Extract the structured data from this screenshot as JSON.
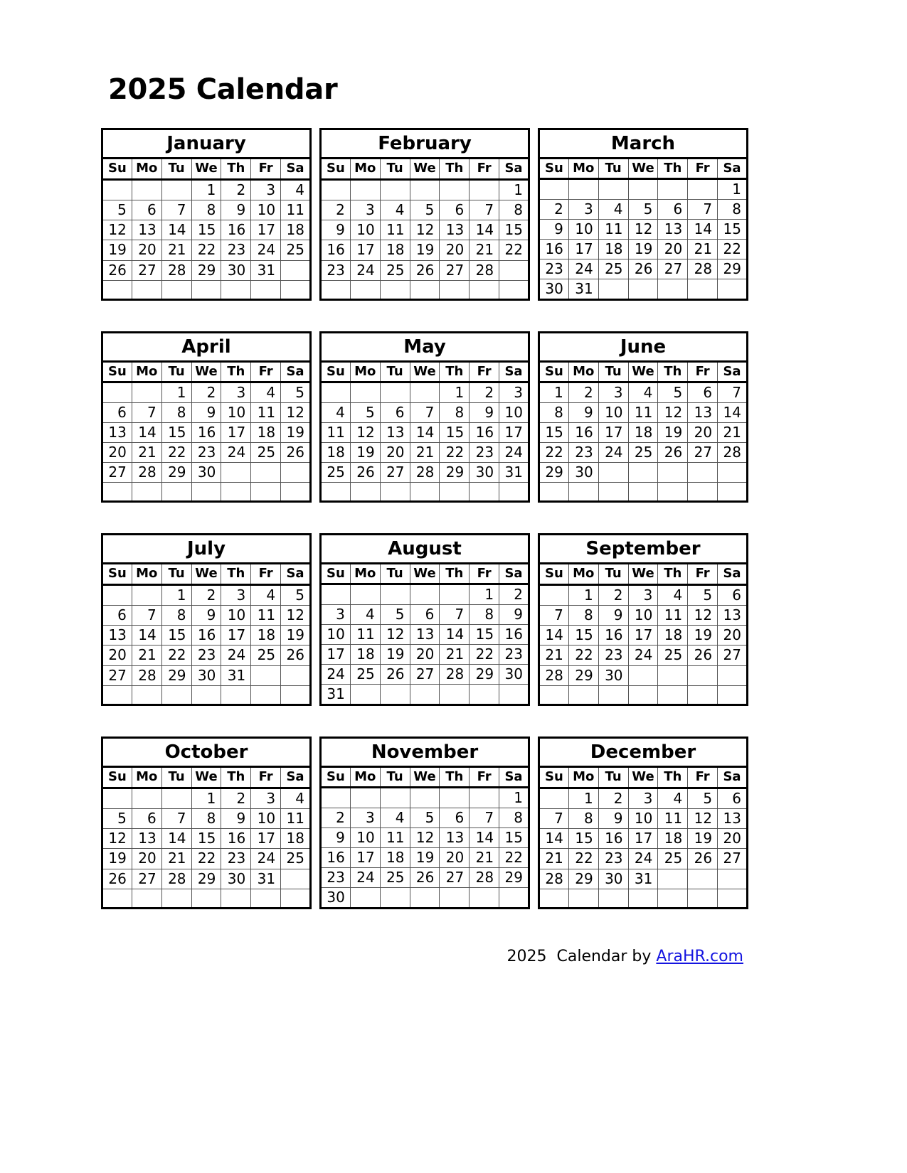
{
  "title": "2025 Calendar",
  "year": "2025",
  "weekday_headers": [
    "Su",
    "Mo",
    "Tu",
    "We",
    "Th",
    "Fr",
    "Sa"
  ],
  "footer": {
    "year": "2025",
    "text": "Calendar by",
    "link_label": "AraHR.com",
    "link_color": "#1414e0"
  },
  "colors": {
    "text": "#000000",
    "background": "#ffffff",
    "outer_border": "#000000",
    "cell_border": "#555555",
    "link": "#1414e0"
  },
  "quarters": [
    {
      "months": [
        {
          "name": "January",
          "weeks": [
            [
              "",
              "",
              "",
              "1",
              "2",
              "3",
              "4"
            ],
            [
              "5",
              "6",
              "7",
              "8",
              "9",
              "10",
              "11"
            ],
            [
              "12",
              "13",
              "14",
              "15",
              "16",
              "17",
              "18"
            ],
            [
              "19",
              "20",
              "21",
              "22",
              "23",
              "24",
              "25"
            ],
            [
              "26",
              "27",
              "28",
              "29",
              "30",
              "31",
              ""
            ],
            [
              "",
              "",
              "",
              "",
              "",
              "",
              ""
            ]
          ]
        },
        {
          "name": "February",
          "weeks": [
            [
              "",
              "",
              "",
              "",
              "",
              "",
              "1"
            ],
            [
              "2",
              "3",
              "4",
              "5",
              "6",
              "7",
              "8"
            ],
            [
              "9",
              "10",
              "11",
              "12",
              "13",
              "14",
              "15"
            ],
            [
              "16",
              "17",
              "18",
              "19",
              "20",
              "21",
              "22"
            ],
            [
              "23",
              "24",
              "25",
              "26",
              "27",
              "28",
              ""
            ],
            [
              "",
              "",
              "",
              "",
              "",
              "",
              ""
            ]
          ]
        },
        {
          "name": "March",
          "weeks": [
            [
              "",
              "",
              "",
              "",
              "",
              "",
              "1"
            ],
            [
              "2",
              "3",
              "4",
              "5",
              "6",
              "7",
              "8"
            ],
            [
              "9",
              "10",
              "11",
              "12",
              "13",
              "14",
              "15"
            ],
            [
              "16",
              "17",
              "18",
              "19",
              "20",
              "21",
              "22"
            ],
            [
              "23",
              "24",
              "25",
              "26",
              "27",
              "28",
              "29"
            ],
            [
              "30",
              "31",
              "",
              "",
              "",
              "",
              ""
            ]
          ]
        }
      ]
    },
    {
      "months": [
        {
          "name": "April",
          "weeks": [
            [
              "",
              "",
              "1",
              "2",
              "3",
              "4",
              "5"
            ],
            [
              "6",
              "7",
              "8",
              "9",
              "10",
              "11",
              "12"
            ],
            [
              "13",
              "14",
              "15",
              "16",
              "17",
              "18",
              "19"
            ],
            [
              "20",
              "21",
              "22",
              "23",
              "24",
              "25",
              "26"
            ],
            [
              "27",
              "28",
              "29",
              "30",
              "",
              "",
              ""
            ],
            [
              "",
              "",
              "",
              "",
              "",
              "",
              ""
            ]
          ]
        },
        {
          "name": "May",
          "weeks": [
            [
              "",
              "",
              "",
              "",
              "1",
              "2",
              "3"
            ],
            [
              "4",
              "5",
              "6",
              "7",
              "8",
              "9",
              "10"
            ],
            [
              "11",
              "12",
              "13",
              "14",
              "15",
              "16",
              "17"
            ],
            [
              "18",
              "19",
              "20",
              "21",
              "22",
              "23",
              "24"
            ],
            [
              "25",
              "26",
              "27",
              "28",
              "29",
              "30",
              "31"
            ],
            [
              "",
              "",
              "",
              "",
              "",
              "",
              ""
            ]
          ]
        },
        {
          "name": "June",
          "weeks": [
            [
              "1",
              "2",
              "3",
              "4",
              "5",
              "6",
              "7"
            ],
            [
              "8",
              "9",
              "10",
              "11",
              "12",
              "13",
              "14"
            ],
            [
              "15",
              "16",
              "17",
              "18",
              "19",
              "20",
              "21"
            ],
            [
              "22",
              "23",
              "24",
              "25",
              "26",
              "27",
              "28"
            ],
            [
              "29",
              "30",
              "",
              "",
              "",
              "",
              ""
            ],
            [
              "",
              "",
              "",
              "",
              "",
              "",
              ""
            ]
          ]
        }
      ]
    },
    {
      "months": [
        {
          "name": "July",
          "weeks": [
            [
              "",
              "",
              "1",
              "2",
              "3",
              "4",
              "5"
            ],
            [
              "6",
              "7",
              "8",
              "9",
              "10",
              "11",
              "12"
            ],
            [
              "13",
              "14",
              "15",
              "16",
              "17",
              "18",
              "19"
            ],
            [
              "20",
              "21",
              "22",
              "23",
              "24",
              "25",
              "26"
            ],
            [
              "27",
              "28",
              "29",
              "30",
              "31",
              "",
              ""
            ],
            [
              "",
              "",
              "",
              "",
              "",
              "",
              ""
            ]
          ]
        },
        {
          "name": "August",
          "weeks": [
            [
              "",
              "",
              "",
              "",
              "",
              "1",
              "2"
            ],
            [
              "3",
              "4",
              "5",
              "6",
              "7",
              "8",
              "9"
            ],
            [
              "10",
              "11",
              "12",
              "13",
              "14",
              "15",
              "16"
            ],
            [
              "17",
              "18",
              "19",
              "20",
              "21",
              "22",
              "23"
            ],
            [
              "24",
              "25",
              "26",
              "27",
              "28",
              "29",
              "30"
            ],
            [
              "31",
              "",
              "",
              "",
              "",
              "",
              ""
            ]
          ]
        },
        {
          "name": "September",
          "weeks": [
            [
              "",
              "1",
              "2",
              "3",
              "4",
              "5",
              "6"
            ],
            [
              "7",
              "8",
              "9",
              "10",
              "11",
              "12",
              "13"
            ],
            [
              "14",
              "15",
              "16",
              "17",
              "18",
              "19",
              "20"
            ],
            [
              "21",
              "22",
              "23",
              "24",
              "25",
              "26",
              "27"
            ],
            [
              "28",
              "29",
              "30",
              "",
              "",
              "",
              ""
            ],
            [
              "",
              "",
              "",
              "",
              "",
              "",
              ""
            ]
          ]
        }
      ]
    },
    {
      "months": [
        {
          "name": "October",
          "weeks": [
            [
              "",
              "",
              "",
              "1",
              "2",
              "3",
              "4"
            ],
            [
              "5",
              "6",
              "7",
              "8",
              "9",
              "10",
              "11"
            ],
            [
              "12",
              "13",
              "14",
              "15",
              "16",
              "17",
              "18"
            ],
            [
              "19",
              "20",
              "21",
              "22",
              "23",
              "24",
              "25"
            ],
            [
              "26",
              "27",
              "28",
              "29",
              "30",
              "31",
              ""
            ],
            [
              "",
              "",
              "",
              "",
              "",
              "",
              ""
            ]
          ]
        },
        {
          "name": "November",
          "weeks": [
            [
              "",
              "",
              "",
              "",
              "",
              "",
              "1"
            ],
            [
              "2",
              "3",
              "4",
              "5",
              "6",
              "7",
              "8"
            ],
            [
              "9",
              "10",
              "11",
              "12",
              "13",
              "14",
              "15"
            ],
            [
              "16",
              "17",
              "18",
              "19",
              "20",
              "21",
              "22"
            ],
            [
              "23",
              "24",
              "25",
              "26",
              "27",
              "28",
              "29"
            ],
            [
              "30",
              "",
              "",
              "",
              "",
              "",
              ""
            ]
          ]
        },
        {
          "name": "December",
          "weeks": [
            [
              "",
              "1",
              "2",
              "3",
              "4",
              "5",
              "6"
            ],
            [
              "7",
              "8",
              "9",
              "10",
              "11",
              "12",
              "13"
            ],
            [
              "14",
              "15",
              "16",
              "17",
              "18",
              "19",
              "20"
            ],
            [
              "21",
              "22",
              "23",
              "24",
              "25",
              "26",
              "27"
            ],
            [
              "28",
              "29",
              "30",
              "31",
              "",
              "",
              ""
            ],
            [
              "",
              "",
              "",
              "",
              "",
              "",
              ""
            ]
          ]
        }
      ]
    }
  ]
}
